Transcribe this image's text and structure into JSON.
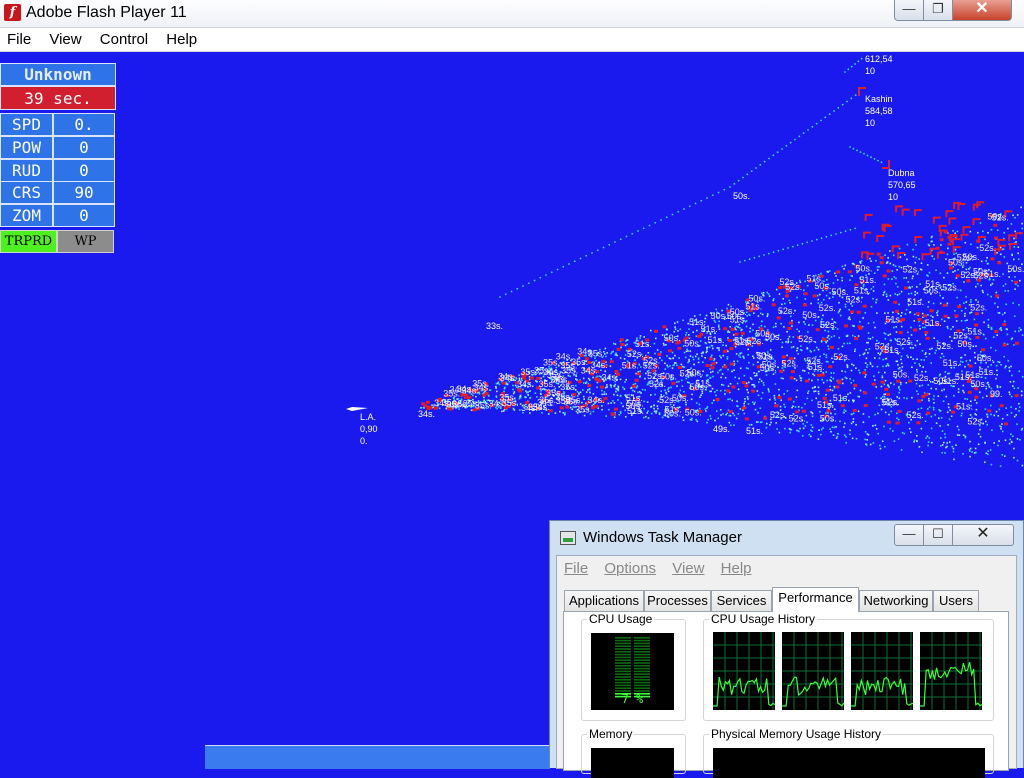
{
  "flash_window": {
    "title": "Adobe Flash Player 11",
    "menu": [
      "File",
      "View",
      "Control",
      "Help"
    ],
    "close_glyph": "✕",
    "max_glyph": "❐",
    "min_glyph": "—"
  },
  "hud": {
    "status": "Unknown",
    "timer": "39 sec.",
    "rows": [
      {
        "label": "SPD",
        "value": "0."
      },
      {
        "label": "POW",
        "value": "0"
      },
      {
        "label": "RUD",
        "value": "0"
      },
      {
        "label": "CRS",
        "value": "90"
      },
      {
        "label": "ZOM",
        "value": "0"
      }
    ],
    "buttons": {
      "trprd": "TRPRD",
      "wp": "WP"
    },
    "colors": {
      "panel": "#2f73e8",
      "timer": "#d21f2f",
      "trprd": "#4ef020",
      "wp": "#8c8c8c",
      "map_bg": "#1a1aee"
    }
  },
  "map": {
    "own_ship": {
      "name": "L.A.",
      "line1": "0,90",
      "line2": "0."
    },
    "ships": [
      {
        "name": "",
        "line1": "612,54",
        "line2": "10"
      },
      {
        "name": "Kashin",
        "line1": "584,58",
        "line2": "10"
      },
      {
        "name": "Dubna",
        "line1": "570,65",
        "line2": "10"
      }
    ],
    "time_labels": [
      "50s.",
      "33s.",
      "34s.",
      "35s.",
      "49s.",
      "51s.",
      "50s.",
      "52s.",
      "99."
    ]
  },
  "task_manager": {
    "title": "Windows Task Manager",
    "menu": [
      "File",
      "Options",
      "View",
      "Help"
    ],
    "tabs": [
      "Applications",
      "Processes",
      "Services",
      "Performance",
      "Networking",
      "Users"
    ],
    "active_tab": "Performance",
    "cpu_usage_label": "CPU Usage",
    "cpu_usage_value": "7 %",
    "cpu_history_label": "CPU Usage History",
    "memory_label": "Memory",
    "phys_mem_label": "Physical Memory Usage History",
    "close_glyph": "✕",
    "max_glyph": "☐",
    "min_glyph": "—",
    "cpu_usage_fraction": 0.07
  }
}
